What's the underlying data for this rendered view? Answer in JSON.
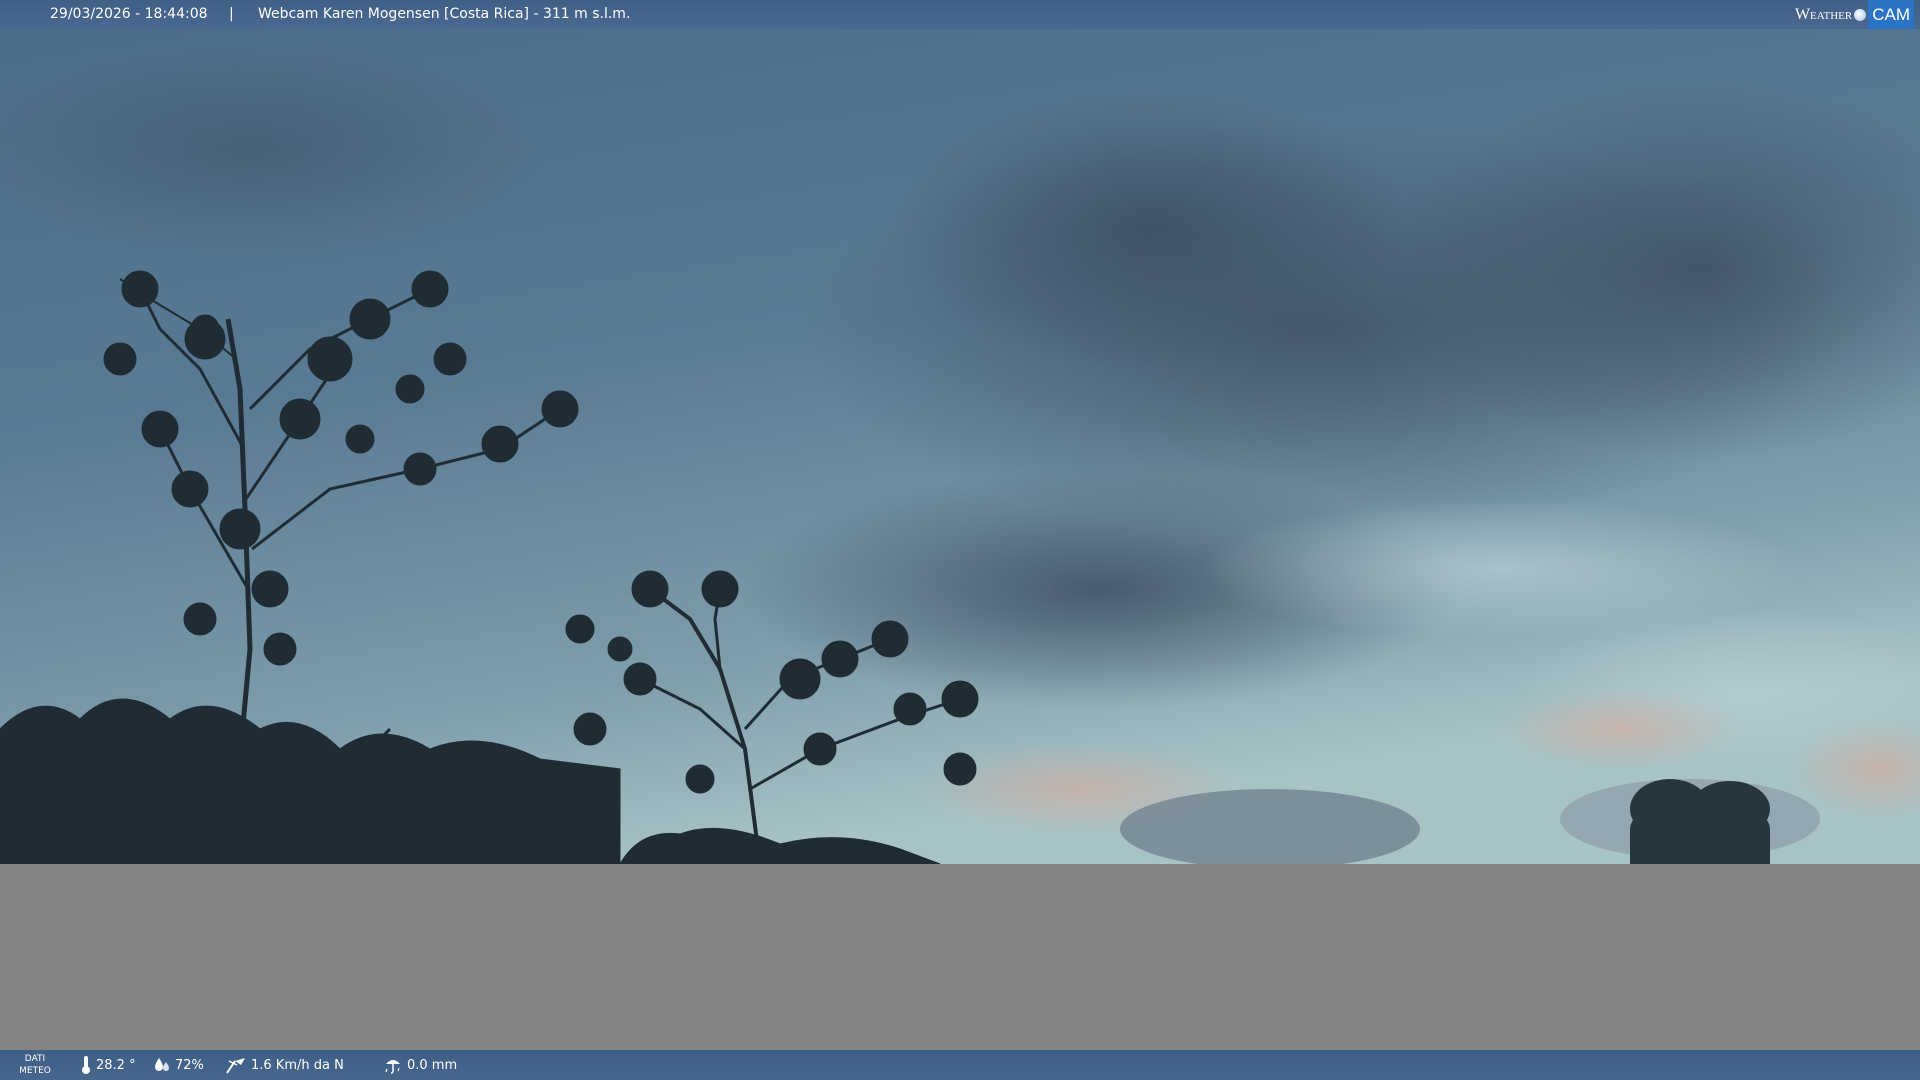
{
  "header": {
    "timestamp": "29/03/2026 - 18:44:08",
    "separator": "|",
    "title": "Webcam Karen Mogensen [Costa Rica]  - 311 m s.l.m.",
    "brand_weather": "Weather",
    "brand_cam": "CAM"
  },
  "footer": {
    "dati_line1": "DATI",
    "dati_line2": "METEO",
    "temperature": "28.2 °",
    "humidity": "72%",
    "wind": "1.6 Km/h da N",
    "rain": "0.0 mm"
  },
  "colors": {
    "bar": "#42638a",
    "sky_top": "#4e6f8a",
    "sky_horizon": "#a9c4c9",
    "silhouette": "#1f2c34",
    "ground_gray": "#848484",
    "brand_cam_bg": "#2b73c4"
  },
  "icons": [
    "thermometer-icon",
    "humidity-icon",
    "wind-icon",
    "rain-icon",
    "weathercam-logo"
  ]
}
